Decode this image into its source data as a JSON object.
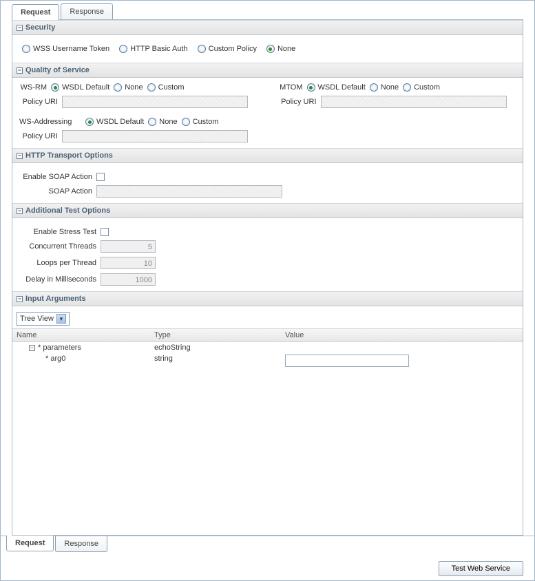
{
  "tabs": {
    "request": "Request",
    "response": "Response"
  },
  "security": {
    "title": "Security",
    "options": {
      "wss": "WSS Username Token",
      "http": "HTTP Basic Auth",
      "custom": "Custom Policy",
      "none": "None"
    },
    "selected": "none"
  },
  "qos": {
    "title": "Quality of Service",
    "wsrm_label": "WS-RM",
    "mtom_label": "MTOM",
    "wsaddr_label": "WS-Addressing",
    "policy_uri_label": "Policy URI",
    "opts": {
      "wsdl": "WSDL Default",
      "none": "None",
      "custom": "Custom"
    }
  },
  "http": {
    "title": "HTTP Transport Options",
    "enable_soap_label": "Enable SOAP Action",
    "soap_action_label": "SOAP Action"
  },
  "additional": {
    "title": "Additional Test Options",
    "enable_stress_label": "Enable Stress Test",
    "threads_label": "Concurrent Threads",
    "loops_label": "Loops per Thread",
    "delay_label": "Delay in Milliseconds",
    "threads_val": "5",
    "loops_val": "10",
    "delay_val": "1000"
  },
  "input_args": {
    "title": "Input Arguments",
    "view_mode": "Tree View",
    "cols": {
      "name": "Name",
      "type": "Type",
      "value": "Value"
    },
    "rows": [
      {
        "name": "* parameters",
        "type": "echoString",
        "value": null,
        "expandable": true
      },
      {
        "name": "* arg0",
        "type": "string",
        "value": "",
        "expandable": false
      }
    ]
  },
  "footer": {
    "test_btn": "Test Web Service"
  }
}
